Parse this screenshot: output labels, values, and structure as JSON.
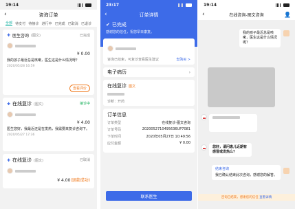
{
  "p1": {
    "time": "19:14",
    "title": "咨询订单",
    "tabs": [
      "全部",
      "待支付",
      "待接诊",
      "进行中",
      "已完成",
      "已取消",
      "已退诊"
    ],
    "cards": [
      {
        "title": "医生咨询",
        "sub": "(图文)",
        "status": "已完成",
        "price": "¥ 0.00",
        "desc": "我的孩子最近总是咳嗽，医生这是什么情况呀？",
        "time": "2020/05/28 16:59",
        "btn": "查看评价"
      },
      {
        "title": "在线复诊",
        "sub": "(图文)",
        "status": "接诊中",
        "price": "¥ 4.00",
        "desc": "医生您好，我最近还是在发热，我需要来复诊咨询下。",
        "time": "2020/05/27 17:36"
      },
      {
        "title": "在线复诊",
        "sub": "(图文)",
        "status": "已取消",
        "price": "¥ 4.00",
        "refund": "(退款成功)"
      }
    ]
  },
  "p2": {
    "time": "23:17",
    "title": "订单详情",
    "done": "已完成",
    "done_sub": "感谢您的信任，祝您早日康复。",
    "hint": "咨询已结束，可复诊查看医生建议",
    "hint_link": "去购买 >",
    "emr": "电子病历",
    "fuzhen": "在线复诊",
    "fuzhen_tag": "图文",
    "diag_label": "诊断：",
    "diag_val": "开药",
    "order_title": "订单信息",
    "rows": [
      {
        "k": "订单类型",
        "v": "在线复诊-图文咨询"
      },
      {
        "k": "订单号码",
        "v": "2020052710495636UP7081"
      },
      {
        "k": "下单时间",
        "v": "2020年05月27日 10:49:56"
      },
      {
        "k": "应付金额",
        "v": "¥ 0.00"
      }
    ],
    "btn": "联系医生"
  },
  "p3": {
    "time": "19:14",
    "title": "在线咨询-图文咨询",
    "bubble1": "我的孩子最近总是咳嗽，医生这是什么情况呢？",
    "bubble2": "您好，请问患儿近期有感冒或发热么？",
    "bubble3_title": "结束咨询",
    "bubble3": "我已确认结束此次咨询，感谢您的解答。",
    "notice": "咨询已结束，感谢您的信任",
    "notice_link": "查看详情"
  }
}
